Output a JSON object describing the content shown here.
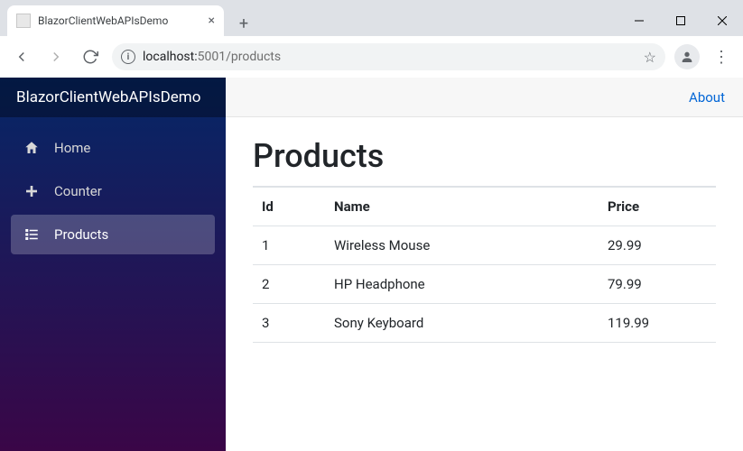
{
  "browser": {
    "tab_title": "BlazorClientWebAPIsDemo",
    "url_host": "localhost:",
    "url_port": "5001",
    "url_path": "/products"
  },
  "brand": "BlazorClientWebAPIsDemo",
  "sidebar": {
    "items": [
      {
        "label": "Home",
        "icon": "home-icon",
        "active": false
      },
      {
        "label": "Counter",
        "icon": "plus-icon",
        "active": false
      },
      {
        "label": "Products",
        "icon": "list-icon",
        "active": true
      }
    ]
  },
  "topbar": {
    "about_label": "About"
  },
  "page": {
    "title": "Products",
    "table": {
      "headers": {
        "id": "Id",
        "name": "Name",
        "price": "Price"
      },
      "rows": [
        {
          "id": "1",
          "name": "Wireless Mouse",
          "price": "29.99"
        },
        {
          "id": "2",
          "name": "HP Headphone",
          "price": "79.99"
        },
        {
          "id": "3",
          "name": "Sony Keyboard",
          "price": "119.99"
        }
      ]
    }
  }
}
